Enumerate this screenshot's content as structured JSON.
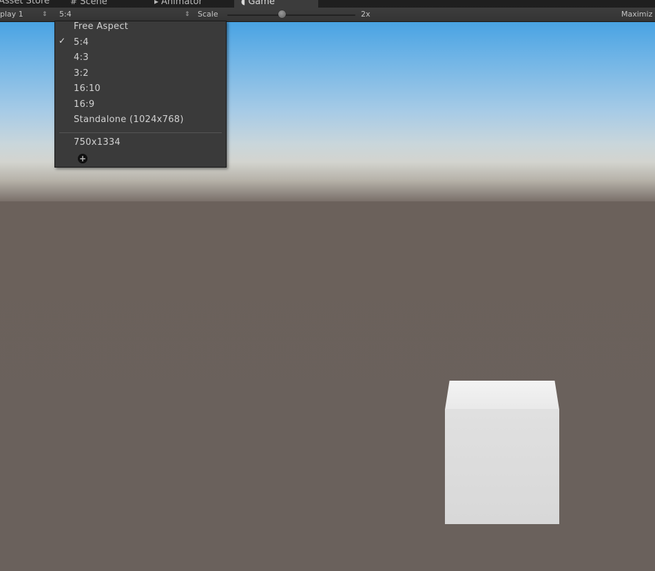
{
  "tabs": [
    {
      "label": "Asset Store",
      "icon": "asset-store-icon"
    },
    {
      "label": "Scene",
      "icon": "scene-grid-icon"
    },
    {
      "label": "Animator",
      "icon": "animator-icon"
    },
    {
      "label": "Game",
      "icon": "game-pacman-icon",
      "active": true
    }
  ],
  "toolbar": {
    "display_label": "play 1",
    "aspect_label": "5:4",
    "scale_label": "Scale",
    "scale_value": "2x",
    "maximize_label": "Maximiz"
  },
  "dropdown": {
    "items": [
      "Free Aspect",
      "5:4",
      "4:3",
      "3:2",
      "16:10",
      "16:9",
      "Standalone (1024x768)"
    ],
    "selected": "5:4",
    "custom_items": [
      "750x1334"
    ],
    "add_icon": "add-circle-icon"
  },
  "colors": {
    "sky_top": "#49a3e3",
    "horizon": "#d3d4cf",
    "ground": "#6a615c",
    "cube": "#dcdcdc"
  }
}
